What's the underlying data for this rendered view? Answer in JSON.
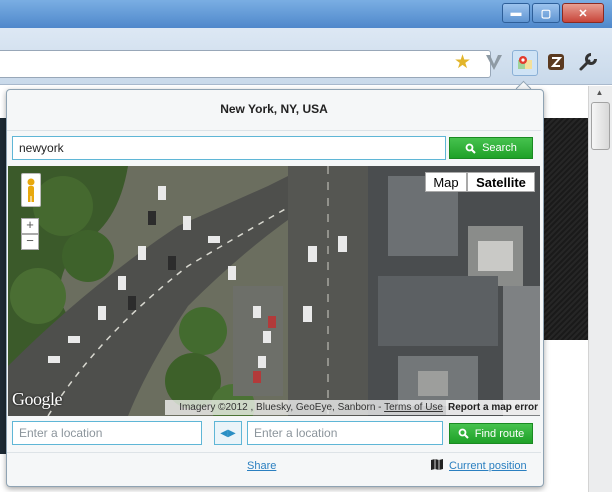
{
  "window": {
    "minimize": "▬",
    "maximize": "▢",
    "close": "✕"
  },
  "popup": {
    "title": "New York, NY, USA",
    "search": {
      "value": "newyork",
      "button": "Search"
    },
    "map": {
      "type_map": "Map",
      "type_satellite": "Satellite",
      "zoom_in": "+",
      "zoom_out": "−",
      "logo": "Google",
      "attribution_prefix": "Imagery ©2012 , Bluesky, GeoEye, Sanborn - ",
      "attribution_terms": "Terms of Use",
      "report": "Report a map error"
    },
    "route": {
      "from_placeholder": "Enter a location",
      "to_placeholder": "Enter a location",
      "swap_icon": "swap-arrows-icon",
      "button": "Find route"
    },
    "links": {
      "share": "Share",
      "current_position": "Current position"
    }
  },
  "colors": {
    "accent_green": "#2db536",
    "input_border": "#5fb6d6",
    "link": "#2a7fc0"
  }
}
